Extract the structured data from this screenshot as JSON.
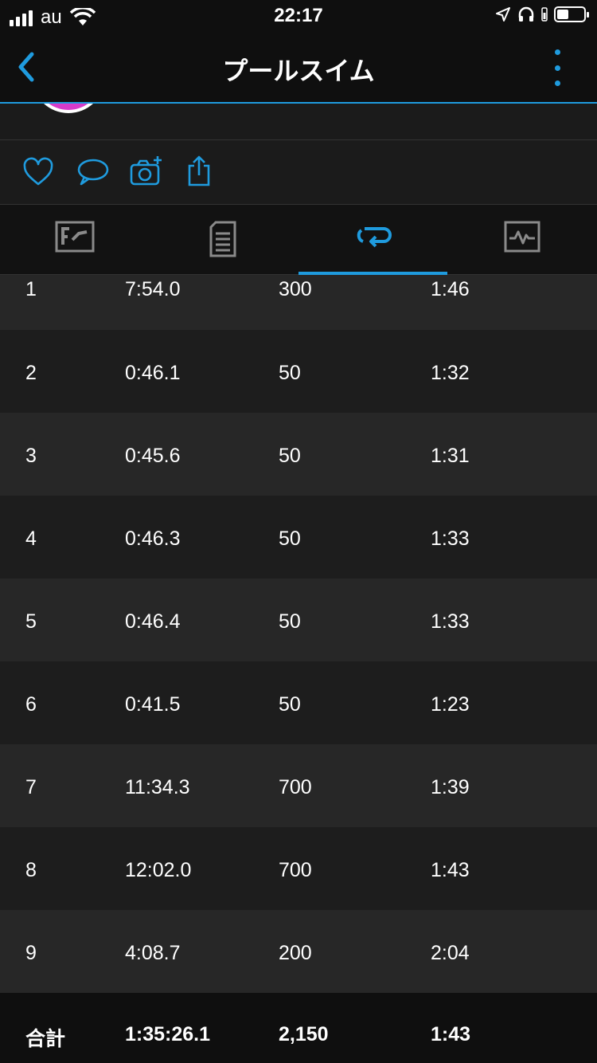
{
  "status_bar": {
    "carrier": "au",
    "time": "22:17"
  },
  "nav": {
    "title": "プールスイム"
  },
  "actions": [
    "heart-icon",
    "comment-icon",
    "add-photo-icon",
    "share-icon"
  ],
  "tabs": [
    {
      "icon": "overview-icon",
      "active": false
    },
    {
      "icon": "details-icon",
      "active": false
    },
    {
      "icon": "laps-icon",
      "active": true
    },
    {
      "icon": "charts-icon",
      "active": false
    }
  ],
  "laps": [
    {
      "lap": "1",
      "time": "7:54.0",
      "distance": "300",
      "pace": "1:46"
    },
    {
      "lap": "2",
      "time": "0:46.1",
      "distance": "50",
      "pace": "1:32"
    },
    {
      "lap": "3",
      "time": "0:45.6",
      "distance": "50",
      "pace": "1:31"
    },
    {
      "lap": "4",
      "time": "0:46.3",
      "distance": "50",
      "pace": "1:33"
    },
    {
      "lap": "5",
      "time": "0:46.4",
      "distance": "50",
      "pace": "1:33"
    },
    {
      "lap": "6",
      "time": "0:41.5",
      "distance": "50",
      "pace": "1:23"
    },
    {
      "lap": "7",
      "time": "11:34.3",
      "distance": "700",
      "pace": "1:39"
    },
    {
      "lap": "8",
      "time": "12:02.0",
      "distance": "700",
      "pace": "1:43"
    },
    {
      "lap": "9",
      "time": "4:08.7",
      "distance": "200",
      "pace": "2:04"
    }
  ],
  "total": {
    "label": "合計",
    "time": "1:35:26.1",
    "distance": "2,150",
    "pace": "1:43"
  },
  "colors": {
    "accent": "#1f9bde",
    "avatar": "#d63ac9",
    "background": "#1b1b1b"
  }
}
